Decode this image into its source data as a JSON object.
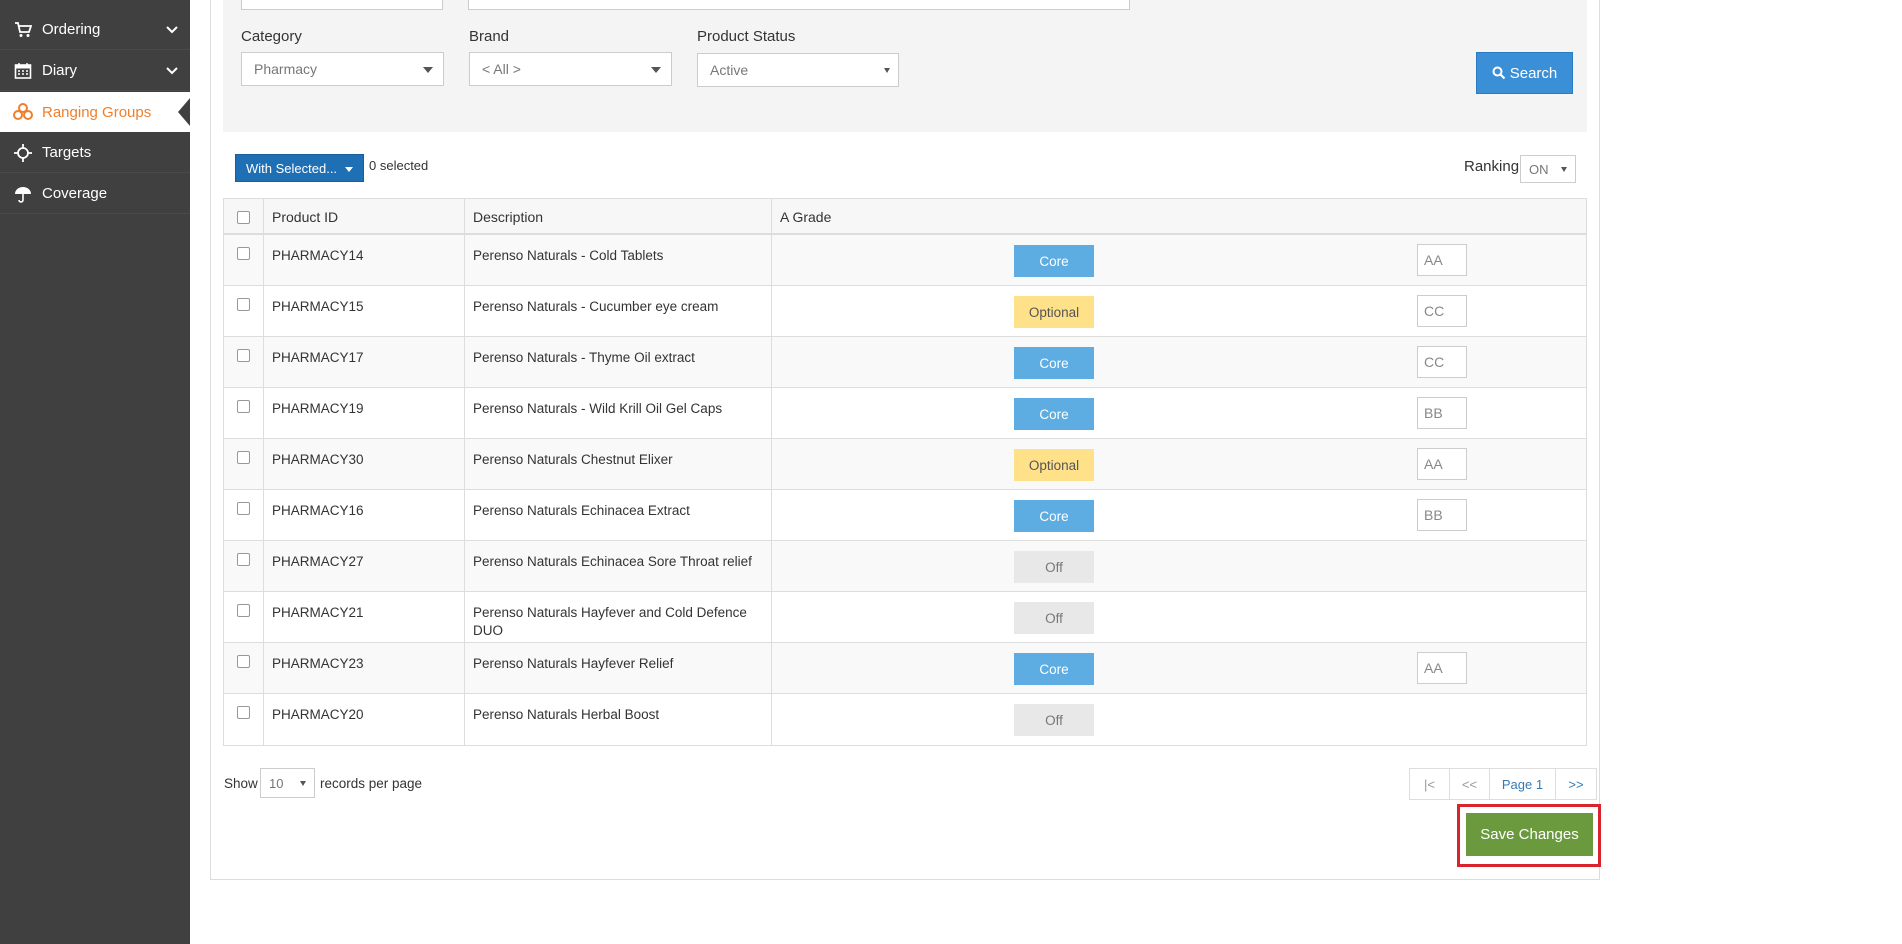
{
  "sidebar": {
    "items": [
      {
        "label": "Ordering",
        "icon": "cart-icon"
      },
      {
        "label": "Diary",
        "icon": "calendar-icon"
      },
      {
        "label": "Ranging Groups",
        "icon": "boxes-icon"
      },
      {
        "label": "Targets",
        "icon": "crosshair-icon"
      },
      {
        "label": "Coverage",
        "icon": "umbrella-icon"
      }
    ],
    "active_color": "#f07f2b"
  },
  "filters": {
    "category_label": "Category",
    "category_value": "Pharmacy",
    "brand_label": "Brand",
    "brand_value": "< All >",
    "status_label": "Product Status",
    "status_value": "Active",
    "search_label": "Search"
  },
  "toolbar": {
    "with_selected": "With Selected...",
    "selected_count": "0 selected",
    "ranking_label": "Ranking",
    "ranking_value": "ON"
  },
  "table": {
    "headers": [
      "Product ID",
      "Description",
      "A Grade"
    ],
    "rows": [
      {
        "id": "PHARMACY14",
        "desc": "Perenso Naturals - Cold Tablets",
        "status": "Core",
        "rank": "AA"
      },
      {
        "id": "PHARMACY15",
        "desc": "Perenso Naturals - Cucumber eye cream",
        "status": "Optional",
        "rank": "CC"
      },
      {
        "id": "PHARMACY17",
        "desc": "Perenso Naturals - Thyme Oil extract",
        "status": "Core",
        "rank": "CC"
      },
      {
        "id": "PHARMACY19",
        "desc": "Perenso Naturals - Wild Krill Oil Gel Caps",
        "status": "Core",
        "rank": "BB"
      },
      {
        "id": "PHARMACY30",
        "desc": "Perenso Naturals Chestnut Elixer",
        "status": "Optional",
        "rank": "AA"
      },
      {
        "id": "PHARMACY16",
        "desc": "Perenso Naturals Echinacea Extract",
        "status": "Core",
        "rank": "BB"
      },
      {
        "id": "PHARMACY27",
        "desc": "Perenso Naturals Echinacea Sore Throat relief",
        "status": "Off",
        "rank": ""
      },
      {
        "id": "PHARMACY21",
        "desc": "Perenso Naturals Hayfever and Cold Defence DUO",
        "status": "Off",
        "rank": ""
      },
      {
        "id": "PHARMACY23",
        "desc": "Perenso Naturals Hayfever Relief",
        "status": "Core",
        "rank": "AA"
      },
      {
        "id": "PHARMACY20",
        "desc": "Perenso Naturals Herbal Boost",
        "status": "Off",
        "rank": ""
      }
    ]
  },
  "footer": {
    "show_label": "Show",
    "per_page_value": "10",
    "per_page_label": "records per page",
    "pager": [
      "|<",
      "<<",
      "Page 1",
      ">>"
    ],
    "save_label": "Save Changes"
  },
  "colors": {
    "core": "#5dade2",
    "optional": "#ffe189",
    "off": "#e8e8e8",
    "save": "#6b9a3e",
    "highlight": "#d9232d"
  }
}
